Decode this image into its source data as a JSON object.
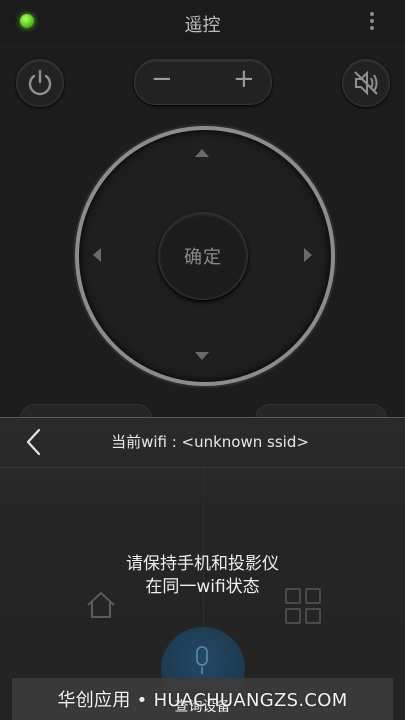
{
  "header": {
    "title": "遥控",
    "status_color": "#57c41f"
  },
  "controls": {
    "volume_minus": "−",
    "volume_plus": "+",
    "ok_label": "确定"
  },
  "wifi_panel": {
    "current_wifi": "当前wifi : <unknown ssid>",
    "message_line1": "请保持手机和投影仪",
    "message_line2": "在同一wifi状态",
    "query_button": "查询设备"
  },
  "watermark": "华创应用 • HUACHUANGZS.COM",
  "icons": [
    "power-icon",
    "mute-icon",
    "menu-icon",
    "back-icon",
    "home-icon",
    "grid-icon",
    "mic-icon"
  ]
}
